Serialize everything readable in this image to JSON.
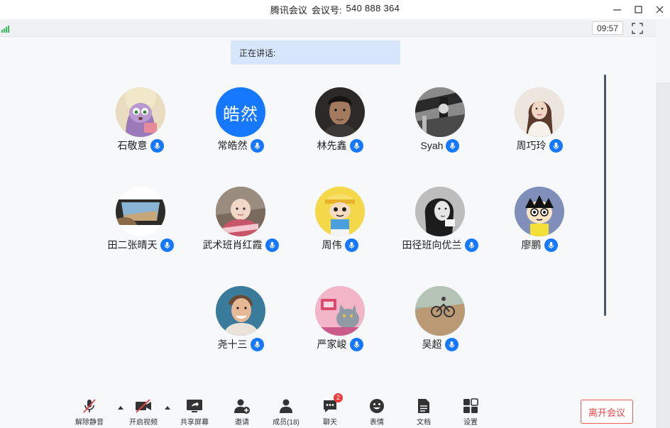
{
  "window": {
    "app_name": "腾讯会议",
    "meeting_id_label": "会议号:",
    "meeting_id": "540 888 364"
  },
  "infobar": {
    "time": "09:57"
  },
  "speaking": {
    "label": "正在讲话:"
  },
  "participants": [
    {
      "name": "石敬意",
      "avatar": "zootopia-fox-photo"
    },
    {
      "name": "常皓然",
      "avatar_text": "皓然"
    },
    {
      "name": "林先鑫",
      "avatar": "portrait-photo"
    },
    {
      "name": "Syah",
      "avatar": "bw-photo"
    },
    {
      "name": "周巧玲",
      "avatar": "girl-photo"
    },
    {
      "name": "田二张晴天",
      "avatar": "car-window-photo"
    },
    {
      "name": "武术班肖红霞",
      "avatar": "baby-photo"
    },
    {
      "name": "周伟",
      "avatar": "cartoon-boy-photo"
    },
    {
      "name": "田径班向优兰",
      "avatar": "bw-woman-photo"
    },
    {
      "name": "廖鹏",
      "avatar": "cartoon-face-photo"
    },
    {
      "name": "尧十三",
      "avatar": "man-smile-photo"
    },
    {
      "name": "严家峻",
      "avatar": "cat-photo"
    },
    {
      "name": "吴超",
      "avatar": "bike-photo"
    }
  ],
  "toolbar": {
    "unmute": "解除静音",
    "start_video": "开启视频",
    "share_screen": "共享屏幕",
    "invite": "邀请",
    "members": "成员(18)",
    "chat": "聊天",
    "chat_badge": "2",
    "reactions": "表情",
    "docs": "文档",
    "settings": "设置",
    "leave": "离开会议"
  },
  "colors": {
    "accent": "#1677ff",
    "leave": "#e94545",
    "signal": "#31c25a",
    "speaking_bg": "#d8e6fb"
  }
}
